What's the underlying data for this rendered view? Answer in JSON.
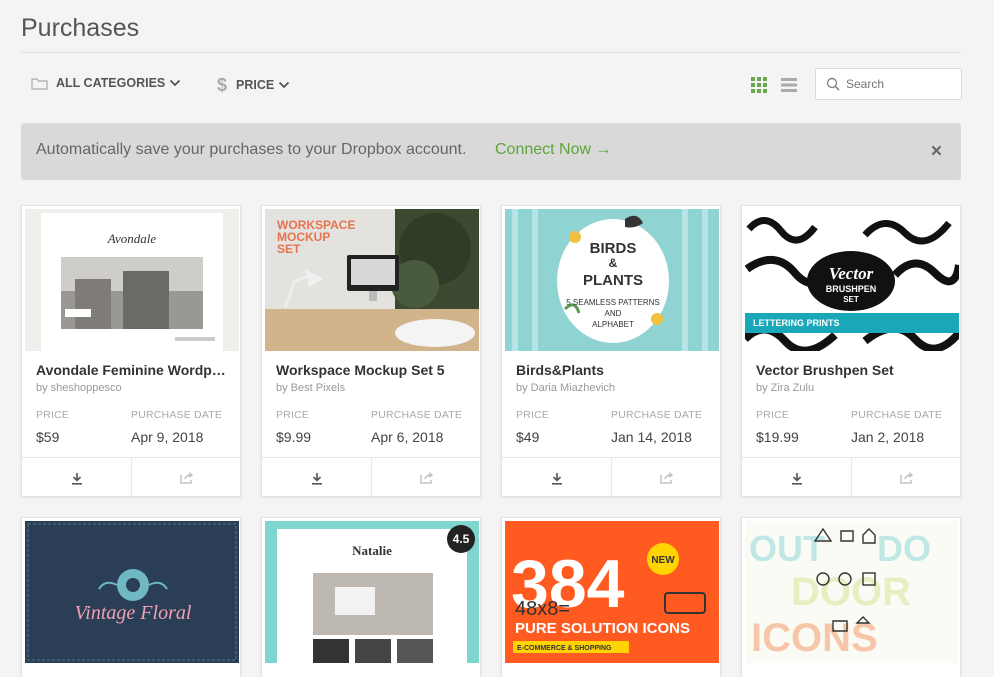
{
  "page": {
    "title": "Purchases"
  },
  "filters": {
    "categories_label": "ALL CATEGORIES",
    "price_label": "PRICE"
  },
  "search": {
    "placeholder": "Search"
  },
  "banner": {
    "text": "Automatically save your purchases to your Dropbox account.",
    "link": "Connect Now →",
    "close": "×"
  },
  "labels": {
    "price": "PRICE",
    "purchase_date": "PURCHASE DATE"
  },
  "products": [
    {
      "title": "Avondale Feminine Wordpress Theme",
      "author": "by sheshoppesco",
      "price": "$59",
      "date": "Apr 9, 2018",
      "thumb_text": [
        "Avondale"
      ]
    },
    {
      "title": "Workspace Mockup Set 5",
      "author": "by Best Pixels",
      "price": "$9.99",
      "date": "Apr 6, 2018",
      "thumb_text": [
        "WORKSPACE",
        "MOCKUP",
        "SET"
      ]
    },
    {
      "title": "Birds&Plants",
      "author": "by Daria Miazhevich",
      "price": "$49",
      "date": "Jan 14, 2018",
      "thumb_text": [
        "BIRDS",
        "&",
        "PLANTS",
        "5 SEAMLESS PATTERNS",
        "AND",
        "ALPHABET"
      ]
    },
    {
      "title": "Vector Brushpen Set",
      "author": "by Zira Zulu",
      "price": "$19.99",
      "date": "Jan 2, 2018",
      "thumb_text": [
        "Vector",
        "BRUSHPEN",
        "SET",
        "LETTERING PRINTS"
      ]
    },
    {
      "thumb_text": [
        "Vintage Floral"
      ]
    },
    {
      "thumb_text": [
        "Natalie"
      ],
      "badge": "4.5"
    },
    {
      "thumb_text": [
        "384",
        "NEW",
        "48x8=",
        "PURE SOLUTION ICONS",
        "E-COMMERCE & SHOPPING"
      ]
    },
    {
      "thumb_text": [
        "OUT",
        "DO",
        "DOOR",
        "ICONS"
      ]
    }
  ],
  "colors": {
    "accent_green": "#5fa53b",
    "banner_bg": "#d9d9d9",
    "page_bg": "#f4f4f4"
  }
}
